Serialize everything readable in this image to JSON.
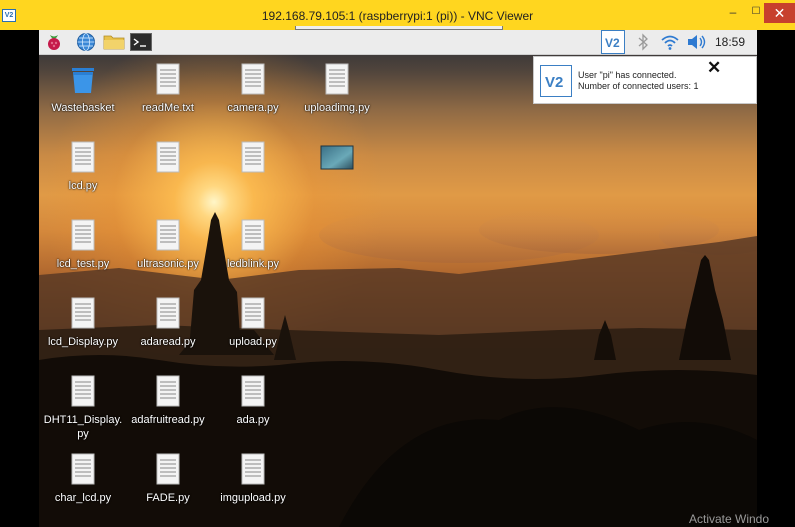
{
  "window": {
    "title": "192.168.79.105:1 (raspberrypi:1 (pi)) - VNC Viewer",
    "icon_text": "V2",
    "minimize": "–",
    "maximize": "☐",
    "close": "✕"
  },
  "panel": {
    "clock": "18:59",
    "icons": [
      "raspberry-pi-menu-icon",
      "web-browser-icon",
      "file-manager-icon",
      "terminal-icon",
      "vnc-server-icon",
      "bluetooth-icon",
      "wifi-icon",
      "volume-icon"
    ]
  },
  "notification": {
    "line1": "User \"pi\" has connected.",
    "line2": "Number of connected users: 1",
    "close": "✕"
  },
  "desktop_icons": [
    {
      "label": "Wastebasket",
      "icon": "wastebasket-icon"
    },
    {
      "label": "readMe.txt",
      "icon": "text-file-icon"
    },
    {
      "label": "camera.py",
      "icon": "text-file-icon"
    },
    {
      "label": "uploadimg.py",
      "icon": "text-file-icon"
    },
    {
      "label": "lcd.py",
      "icon": "text-file-icon"
    },
    {
      "label": "",
      "icon": "text-file-icon"
    },
    {
      "label": "",
      "icon": "text-file-icon"
    },
    {
      "label": "",
      "icon": "image-file-icon"
    },
    {
      "label": "lcd_test.py",
      "icon": "text-file-icon"
    },
    {
      "label": "ultrasonic.py",
      "icon": "text-file-icon"
    },
    {
      "label": "ledblink.py",
      "icon": "text-file-icon"
    },
    {
      "label": "lcd_Display.py",
      "icon": "text-file-icon"
    },
    {
      "label": "adaread.py",
      "icon": "text-file-icon"
    },
    {
      "label": "upload.py",
      "icon": "text-file-icon"
    },
    {
      "label": "DHT11_Display.py",
      "icon": "text-file-icon"
    },
    {
      "label": "adafruitread.py",
      "icon": "text-file-icon"
    },
    {
      "label": "ada.py",
      "icon": "text-file-icon"
    },
    {
      "label": "char_lcd.py",
      "icon": "text-file-icon"
    },
    {
      "label": "FADE.py",
      "icon": "text-file-icon"
    },
    {
      "label": "imgupload.py",
      "icon": "text-file-icon"
    }
  ],
  "watermark": "Activate Windo"
}
